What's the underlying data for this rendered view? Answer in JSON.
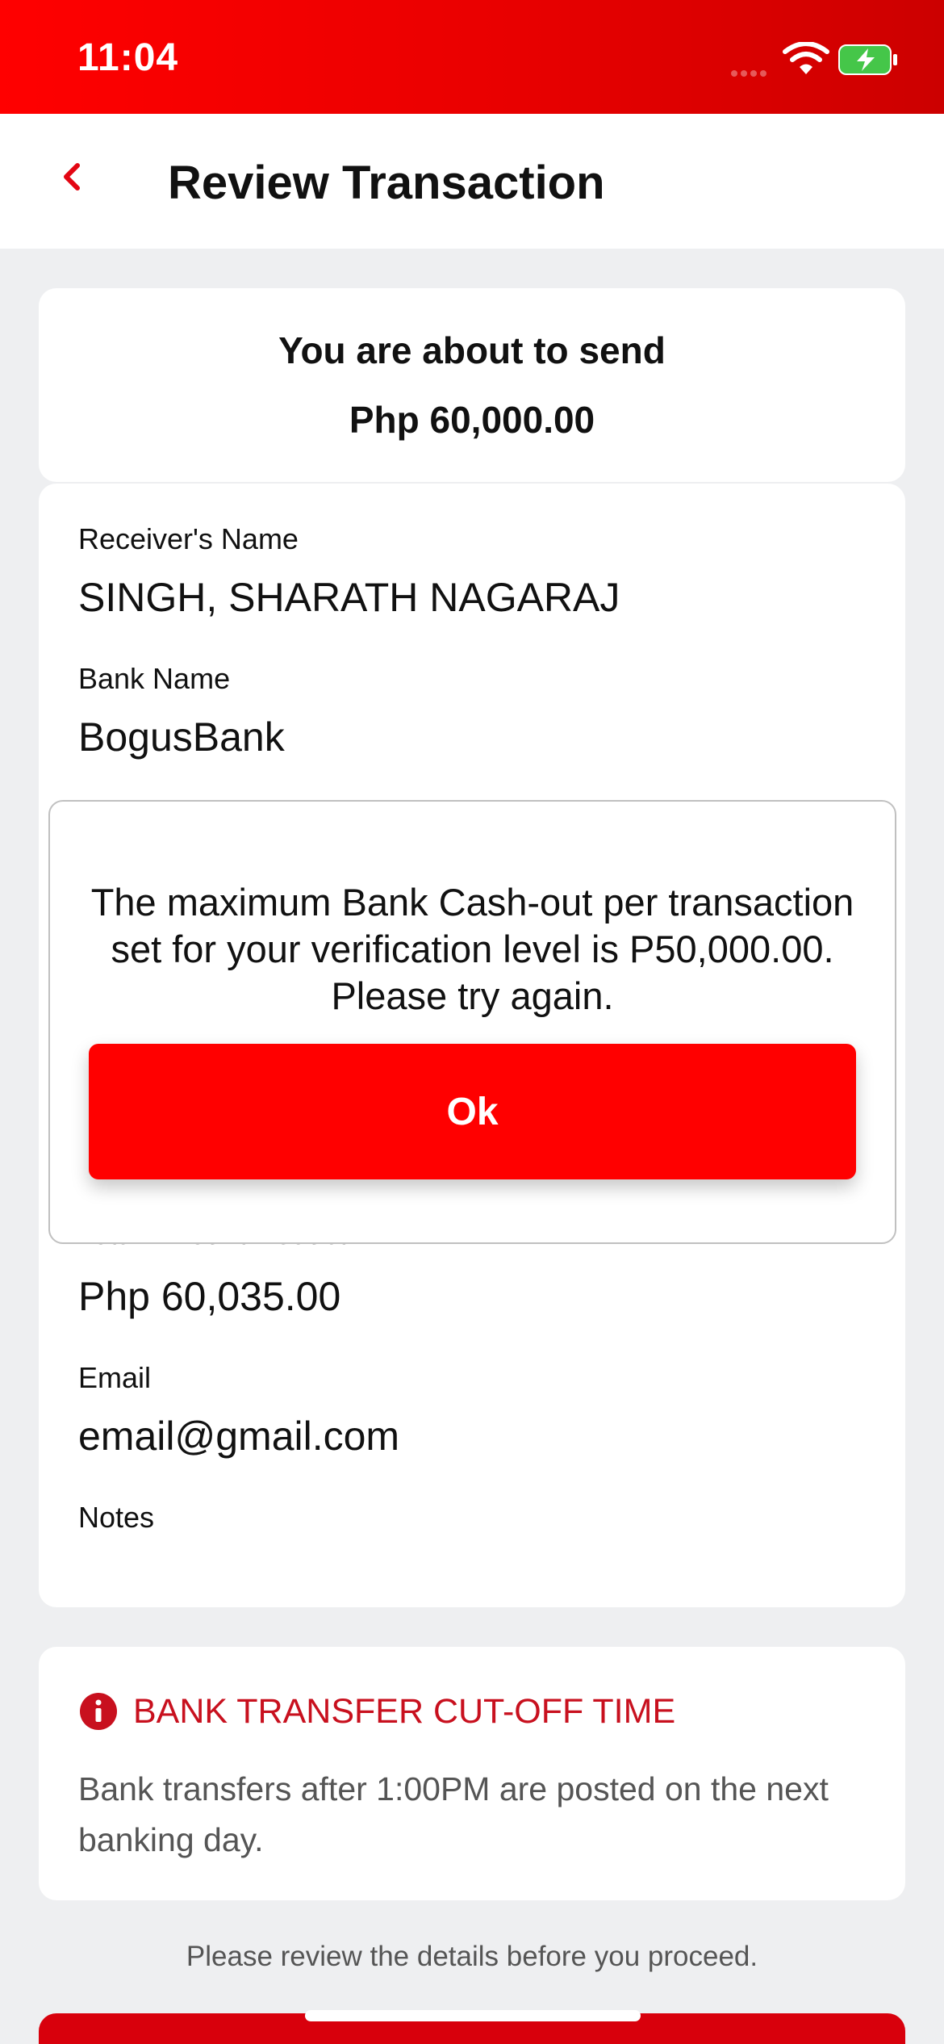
{
  "status_bar": {
    "time": "11:04"
  },
  "header": {
    "title": "Review Transaction",
    "back_icon": "chevron-left-icon"
  },
  "summary": {
    "label": "You are about to send",
    "amount": "Php 60,000.00"
  },
  "details": {
    "receiver_label": "Receiver's Name",
    "receiver_value": "SINGH, SHARATH NAGARAJ",
    "bank_label": "Bank Name",
    "bank_value": "BogusBank",
    "total_label": "Total Amount Deduct",
    "total_value": "Php 60,035.00",
    "email_label": "Email",
    "email_value": "email@gmail.com",
    "notes_label": "Notes"
  },
  "cutoff": {
    "icon": "info-icon",
    "title": "BANK TRANSFER CUT-OFF TIME",
    "text": "Bank transfers after 1:00PM are posted on the next banking day."
  },
  "footnote": "Please review the details before you proceed.",
  "modal": {
    "message": "The maximum Bank Cash-out per transaction set for your verification level is P50,000.00. Please try again.",
    "ok_label": "Ok"
  },
  "colors": {
    "primary_red": "#ff0000",
    "cutoff_red": "#c8101e",
    "background": "#eeeff1"
  }
}
